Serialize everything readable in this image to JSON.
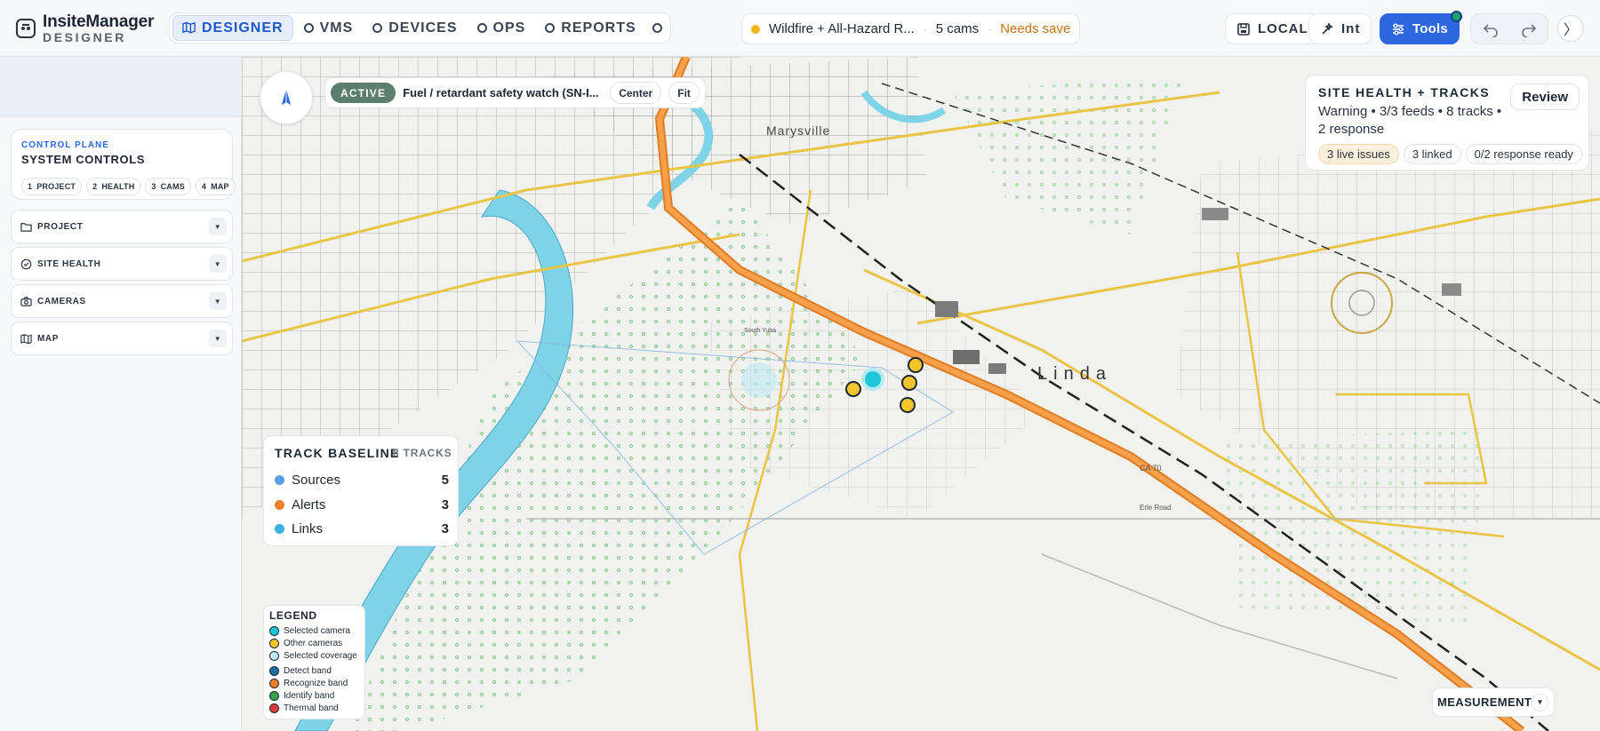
{
  "brand": {
    "name": "InsiteManager",
    "sub": "DESIGNER"
  },
  "nav": {
    "tabs": [
      {
        "label": "DESIGNER",
        "icon": "map-icon",
        "active": true
      },
      {
        "label": "VMS",
        "icon": "circle-icon"
      },
      {
        "label": "DEVICES",
        "icon": "circle-icon"
      },
      {
        "label": "OPS",
        "icon": "circle-icon"
      },
      {
        "label": "REPORTS",
        "icon": "circle-icon"
      }
    ]
  },
  "project_pill": {
    "name": "Wildfire + All-Hazard R...",
    "cams": "5 cams",
    "status": "Needs save"
  },
  "toolbar": {
    "local_label": "LOCAL",
    "int_label": "Int",
    "tools_label": "Tools"
  },
  "left_panel": {
    "control_plane_label": "CONTROL PLANE",
    "title": "SYSTEM CONTROLS",
    "steps": [
      {
        "num": "1",
        "label": "PROJECT"
      },
      {
        "num": "2",
        "label": "HEALTH"
      },
      {
        "num": "3",
        "label": "CAMS"
      },
      {
        "num": "4",
        "label": "MAP"
      }
    ],
    "sections": [
      {
        "label": "PROJECT",
        "icon": "folder-icon"
      },
      {
        "label": "SITE HEALTH",
        "icon": "check-circle-icon"
      },
      {
        "label": "CAMERAS",
        "icon": "camera-icon"
      },
      {
        "label": "MAP",
        "icon": "map-icon"
      }
    ]
  },
  "watch": {
    "badge": "ACTIVE",
    "title": "Fuel / retardant safety watch (SN-I...",
    "center": "Center",
    "fit": "Fit"
  },
  "health": {
    "title": "SITE HEALTH + TRACKS",
    "summary": "Warning • 3/3 feeds • 8 tracks • 2 response",
    "review": "Review",
    "tags": [
      "3 live issues",
      "3 linked",
      "0/2 response ready"
    ]
  },
  "baseline": {
    "title": "TRACK BASELINE",
    "count": "8 TRACKS",
    "rows": [
      {
        "label": "Sources",
        "value": "5",
        "color": "#5b9ee6"
      },
      {
        "label": "Alerts",
        "value": "3",
        "color": "#f07f2a"
      },
      {
        "label": "Links",
        "value": "3",
        "color": "#3ab1e0"
      }
    ]
  },
  "legend": {
    "title": "LEGEND",
    "items": [
      {
        "label": "Selected camera",
        "color": "#1ec6d8"
      },
      {
        "label": "Other cameras",
        "color": "#f3c52c"
      },
      {
        "label": "Selected coverage",
        "color": "#bfe9f4"
      },
      {
        "label": "Detect band",
        "color": "#1f6fa0"
      },
      {
        "label": "Recognize band",
        "color": "#f07f2a"
      },
      {
        "label": "Identify band",
        "color": "#3aa24a"
      },
      {
        "label": "Thermal band",
        "color": "#d93a3a"
      }
    ]
  },
  "map_labels": {
    "town1": "Marysville",
    "town2": "Linda",
    "road1": "CA 70",
    "road2": "Erle Road",
    "place1": "South Yuba"
  },
  "measurement": {
    "label": "MEASUREMENT"
  },
  "colors": {
    "accent": "#2c67e0",
    "active_badge": "#5c7e6f",
    "warning": "#c47513",
    "highway": "#f0902e"
  }
}
